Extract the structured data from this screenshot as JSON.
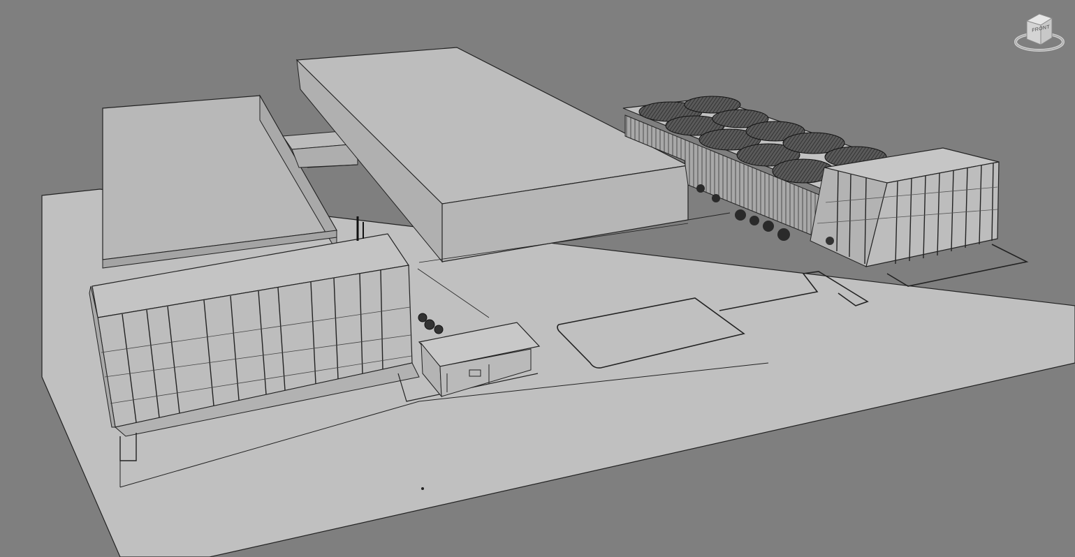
{
  "app": {
    "view_type": "3D perspective view",
    "background_color": "#7f7f7f",
    "site_color": "#c0c0c0",
    "edge_color": "#1a1a1a"
  },
  "viewcube": {
    "icon": "viewcube-icon",
    "face_label": "FRONT"
  }
}
